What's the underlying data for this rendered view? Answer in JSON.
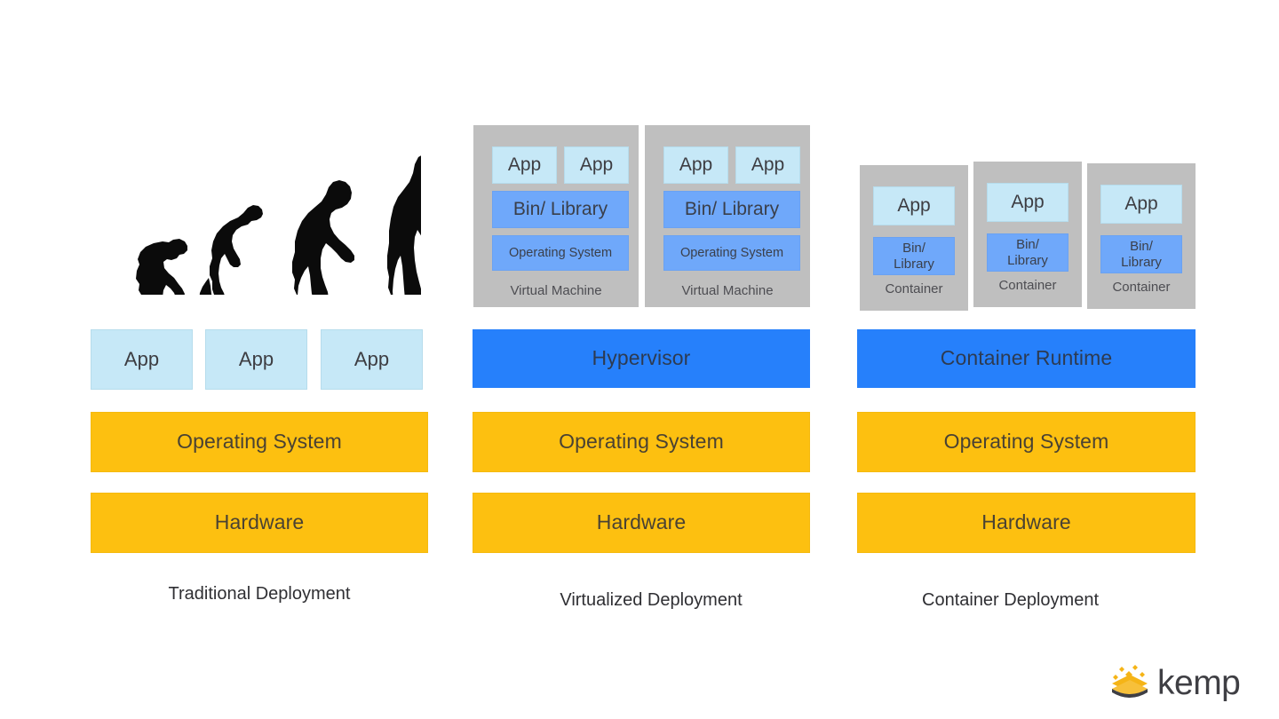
{
  "slide": {
    "background": "#ffffff",
    "palette": {
      "app_light_blue": "#c6e8f7",
      "bin_blue": "#6fa8fa",
      "runtime_blue": "#2680fb",
      "os_yellow": "#fdc010",
      "group_gray": "#bfbfbf",
      "text_dark": "#3d3d42",
      "logo_yellow": "#f5b417"
    }
  },
  "columns": [
    {
      "id": "traditional",
      "caption": "Traditional Deployment",
      "illustration": "human-evolution-silhouette",
      "apps": [
        {
          "label": "App"
        },
        {
          "label": "App"
        },
        {
          "label": "App"
        }
      ],
      "os_label": "Operating System",
      "hardware_label": "Hardware"
    },
    {
      "id": "virtualized",
      "caption": "Virtualized Deployment",
      "groups": [
        {
          "caption": "Virtual Machine",
          "apps": [
            {
              "label": "App"
            },
            {
              "label": "App"
            }
          ],
          "bin_label": "Bin/ Library",
          "os_label": "Operating System"
        },
        {
          "caption": "Virtual Machine",
          "apps": [
            {
              "label": "App"
            },
            {
              "label": "App"
            }
          ],
          "bin_label": "Bin/ Library",
          "os_label": "Operating System"
        }
      ],
      "runtime_label": "Hypervisor",
      "os_label": "Operating System",
      "hardware_label": "Hardware"
    },
    {
      "id": "container",
      "caption": "Container Deployment",
      "groups": [
        {
          "caption": "Container",
          "apps": [
            {
              "label": "App"
            }
          ],
          "bin_label": "Bin/\nLibrary"
        },
        {
          "caption": "Container",
          "apps": [
            {
              "label": "App"
            }
          ],
          "bin_label": "Bin/\nLibrary"
        },
        {
          "caption": "Container",
          "apps": [
            {
              "label": "App"
            }
          ],
          "bin_label": "Bin/\nLibrary"
        }
      ],
      "runtime_label": "Container Runtime",
      "os_label": "Operating System",
      "hardware_label": "Hardware"
    }
  ],
  "logo": {
    "text": "kemp",
    "mark": "kemp-stacked-diamond-mark"
  }
}
